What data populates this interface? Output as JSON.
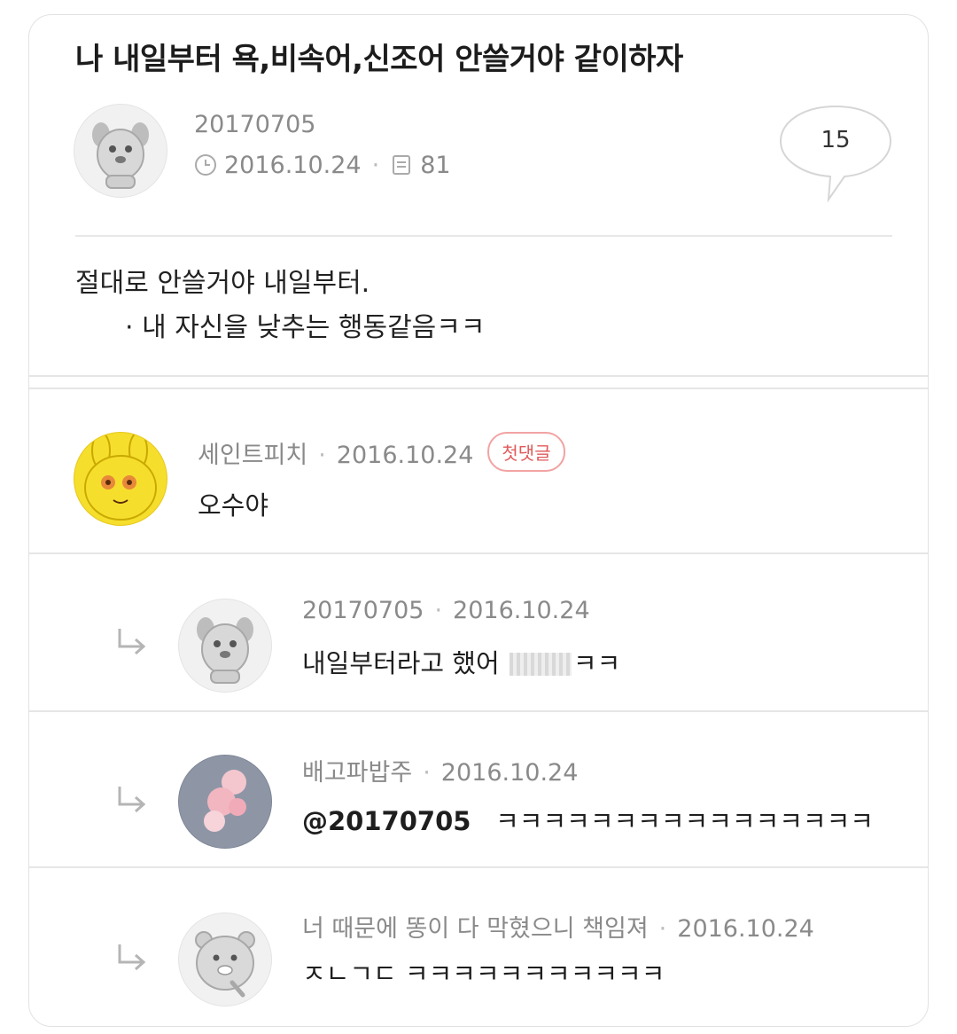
{
  "post": {
    "title": "나 내일부터 욕,비속어,신조어 안쓸거야 같이하자",
    "author": "20170705",
    "date": "2016.10.24",
    "views": "81",
    "comment_count": "15",
    "body_line1": "절대로 안쓸거야 내일부터.",
    "body_line2": "· 내 자신을 낮추는 행동같음ㅋㅋ"
  },
  "comments": [
    {
      "author": "세인트피치",
      "date": "2016.10.24",
      "badge": "첫댓글",
      "text": "오수야"
    },
    {
      "author": "20170705",
      "date": "2016.10.24",
      "text_before": "내일부터라고 했어 ",
      "text_after": "ㅋㅋ"
    },
    {
      "author": "배고파밥주",
      "date": "2016.10.24",
      "mention": "@20170705",
      "text": "ㅋㅋㅋㅋㅋㅋㅋㅋㅋㅋㅋㅋㅋㅋㅋㅋ"
    },
    {
      "author": "너 때문에 똥이 다 막혔으니 책임져",
      "date": "2016.10.24",
      "text": "ㅈㄴㄱㄷ ㅋㅋㅋㅋㅋㅋㅋㅋㅋㅋㅋ"
    }
  ],
  "icons": {
    "date": "clock-icon",
    "views": "document-icon",
    "comments": "speech-bubble-icon",
    "reply": "reply-arrow-icon"
  },
  "colors": {
    "meta_text": "#8a8a8a",
    "badge": "#e05a5a",
    "avatar_yellow": "#f6de2d"
  }
}
